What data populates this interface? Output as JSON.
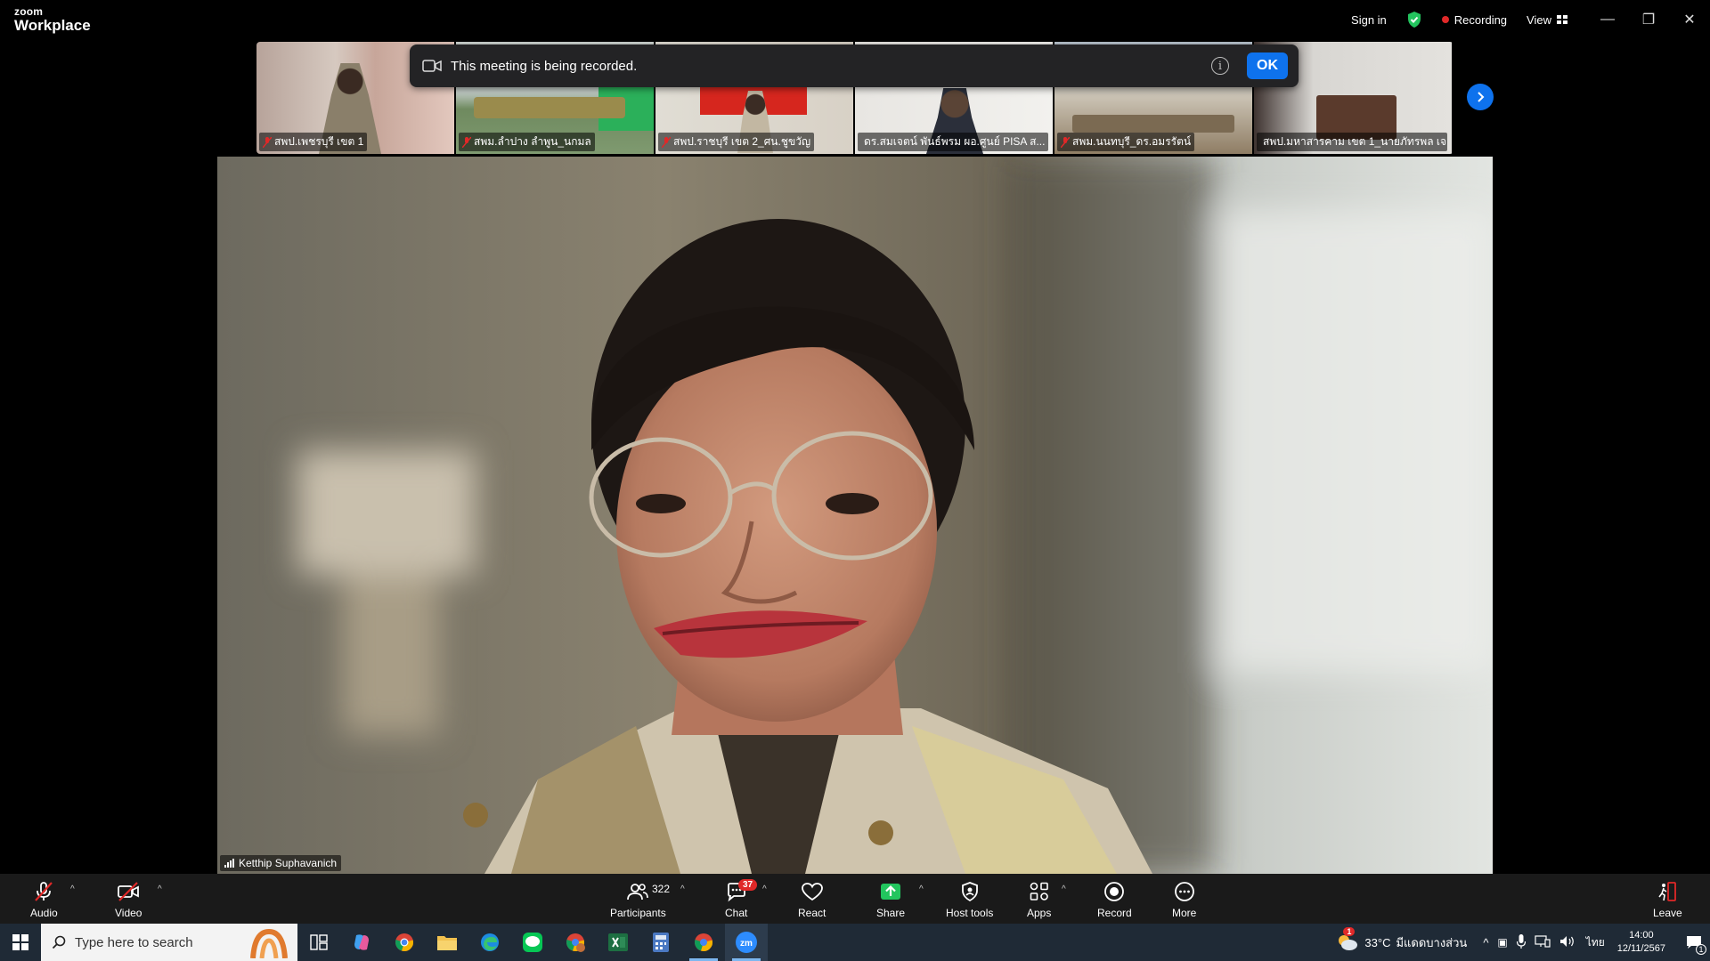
{
  "app": {
    "brand_top": "zoom",
    "brand_bottom": "Workplace"
  },
  "titlebar": {
    "sign_in": "Sign in",
    "recording": "Recording",
    "view": "View"
  },
  "banner": {
    "text": "This meeting is being recorded.",
    "ok": "OK"
  },
  "gallery": [
    {
      "name": "สพป.เพชรบุรี เขต 1"
    },
    {
      "name": "สพม.ลำปาง ลำพูน_นกมล"
    },
    {
      "name": "สพป.ราชบุรี เขต 2_ศน.ชูขวัญ"
    },
    {
      "name": "ดร.สมเจตน์ พันธ์พรม ผอ.ศูนย์ PISA ส..."
    },
    {
      "name": "สพม.นนทบุรี_ดร.อมรรัตน์"
    },
    {
      "name": "สพป.มหาสารคาม เขต 1_นายภัทรพล เจ..."
    }
  ],
  "speaker": {
    "name": "Ketthip Suphavanich"
  },
  "toolbar": {
    "audio": "Audio",
    "video": "Video",
    "participants": "Participants",
    "participants_count": "322",
    "chat": "Chat",
    "chat_badge": "37",
    "react": "React",
    "share": "Share",
    "host_tools": "Host tools",
    "apps": "Apps",
    "record": "Record",
    "more": "More",
    "leave": "Leave"
  },
  "taskbar": {
    "search_placeholder": "Type here to search",
    "weather": "33°C",
    "weather_desc": "มีแดดบางส่วน",
    "weather_badge": "1",
    "lang": "ไทย",
    "time": "14:00",
    "date": "12/11/2567",
    "notif_count": "1"
  },
  "colors": {
    "accent": "#0e72ed",
    "record": "#e02828",
    "share": "#22c55e"
  }
}
